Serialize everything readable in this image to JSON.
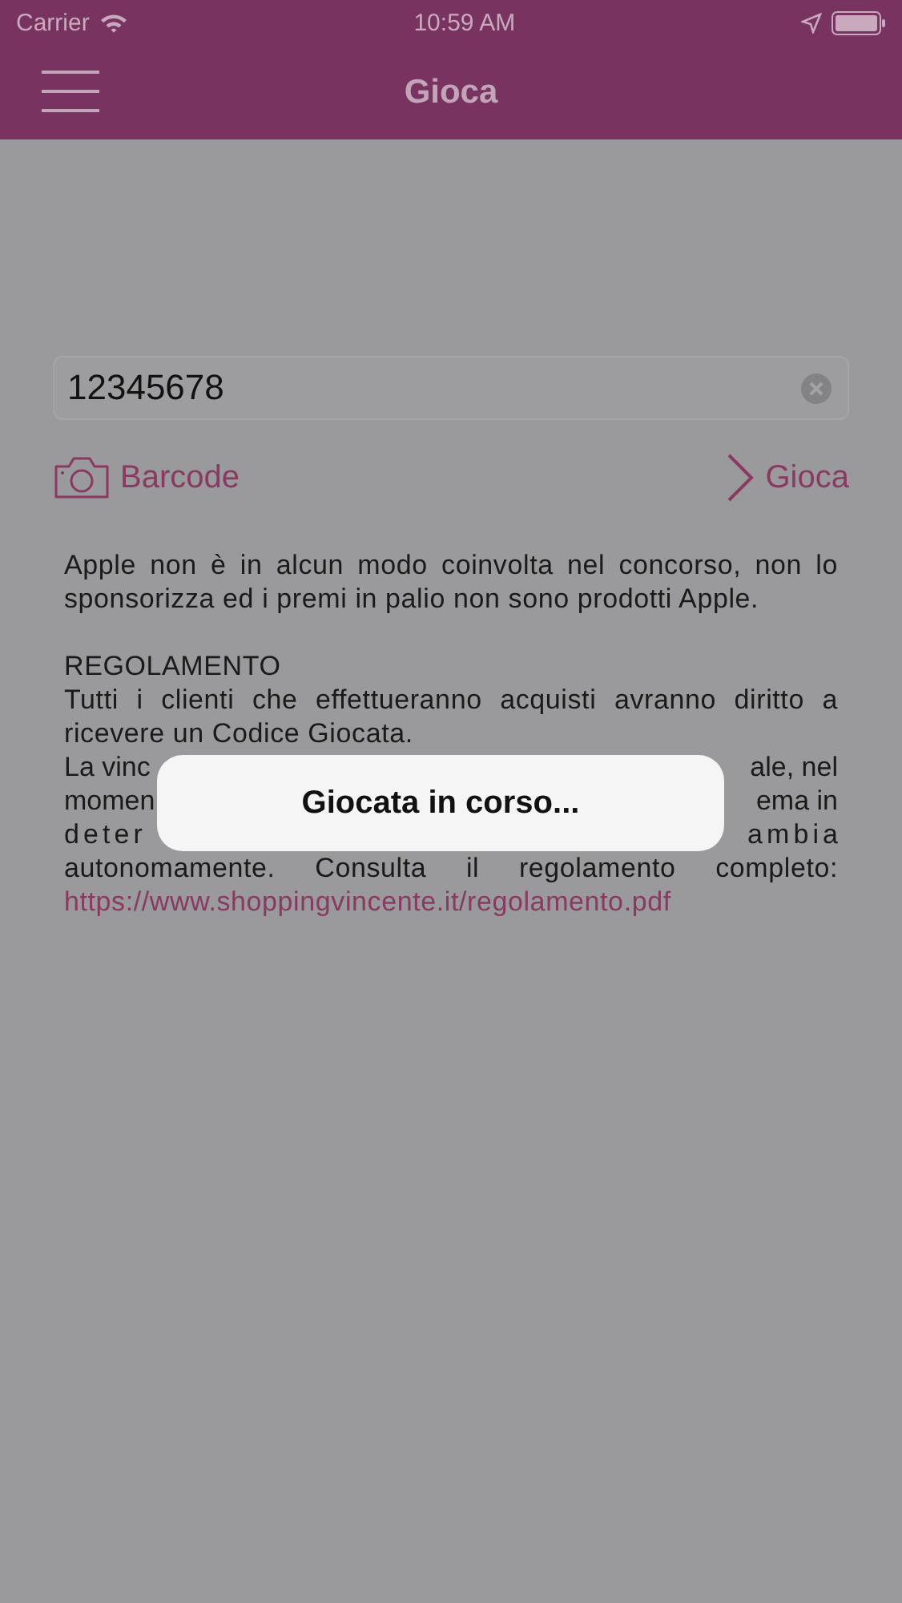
{
  "status_bar": {
    "carrier": "Carrier",
    "time": "10:59 AM"
  },
  "nav": {
    "title": "Gioca"
  },
  "code_field": {
    "value": "12345678"
  },
  "actions": [
    {
      "kind": "barcode",
      "label": "Barcode"
    },
    {
      "kind": "play",
      "label": "Gioca"
    }
  ],
  "disclaimer": "Apple non è in alcun modo coinvolta nel concorso, non lo sponsorizza ed i premi in palio non sono prodotti Apple.",
  "rules": {
    "heading": "REGOLAMENTO",
    "paragraph": "Tutti i clienti che effettueranno acquisti avranno diritto a ricevere un Codice Giocata.",
    "partial_lines": [
      {
        "left": "La vinc",
        "right": "ale, nel",
        "spaced": false
      },
      {
        "left": "momen",
        "right": "ema in",
        "spaced": false
      },
      {
        "left": "deter",
        "right": "ambia",
        "spaced": true
      }
    ],
    "last_line": "autonomamente. Consulta il regolamento completo:",
    "link": "https://www.shoppingvincente.it/regolamento.pdf"
  },
  "dialog": {
    "message": "Giocata in corso..."
  }
}
